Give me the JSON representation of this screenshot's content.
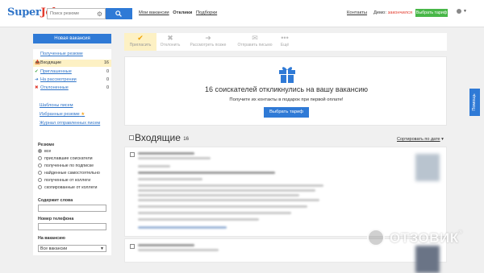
{
  "header": {
    "logo_part1": "Super",
    "logo_part2": "Job",
    "search_placeholder": "Поиск резюме",
    "nav": {
      "my_vacancies": "Мои вакансии",
      "responses": "Отклики",
      "selections": "Подборки"
    },
    "contacts": "Контакты",
    "demo_label": "Демо:",
    "demo_status": "закончился",
    "tariff_button": "Выбрать тариф"
  },
  "sidebar": {
    "new_vacancy_button": "Новая вакансия",
    "received_resumes": "Полученные резюме",
    "folders": [
      {
        "label": "Входящие",
        "count": "16",
        "icon": "inbox-icon"
      },
      {
        "label": "Приглашенные",
        "count": "0",
        "icon": "check-icon"
      },
      {
        "label": "На рассмотрении",
        "count": "0",
        "icon": "forward-icon"
      },
      {
        "label": "Отклоненные",
        "count": "0",
        "icon": "close-icon"
      }
    ],
    "links": {
      "templates": "Шаблоны писем",
      "favorites": "Избранные резюме",
      "journal": "Журнал отправленных писем"
    }
  },
  "filters": {
    "resume_heading": "Резюме",
    "options": [
      "все",
      "приславшие соискатели",
      "полученные по подписке",
      "найденные самостоятельно",
      "полученные от коллеги",
      "скопированные от коллеги"
    ],
    "selected_index": 0,
    "keywords_label": "Содержит слова",
    "phone_label": "Номер телефона",
    "vacancy_label": "На вакансию",
    "vacancy_value": "Все вакансии"
  },
  "toolbar": {
    "items": [
      {
        "label": "Пригласить",
        "icon": "check-icon"
      },
      {
        "label": "Отклонить",
        "icon": "close-icon"
      },
      {
        "label": "Рассмотреть позже",
        "icon": "forward-icon"
      },
      {
        "label": "Отправить письмо",
        "icon": "mail-icon"
      },
      {
        "label": "Ещё",
        "icon": "more-icon"
      }
    ]
  },
  "promo": {
    "title": "16 соискателей откликнулись на вашу вакансию",
    "subtitle": "Получите их контакты в подарок при первой оплате!",
    "button": "Выбрать тариф"
  },
  "inbox": {
    "title": "Входящие",
    "count": "16",
    "sort_label": "Сортировать по дате"
  },
  "feedback_tab": "Помощь",
  "watermark": {
    "text": "ОТЗОВИК",
    "mark": "®"
  },
  "colors": {
    "accent": "#2f7ad6",
    "brand_red": "#e23a2c",
    "tariff_green": "#48b748",
    "highlight": "#fdf1c4"
  }
}
